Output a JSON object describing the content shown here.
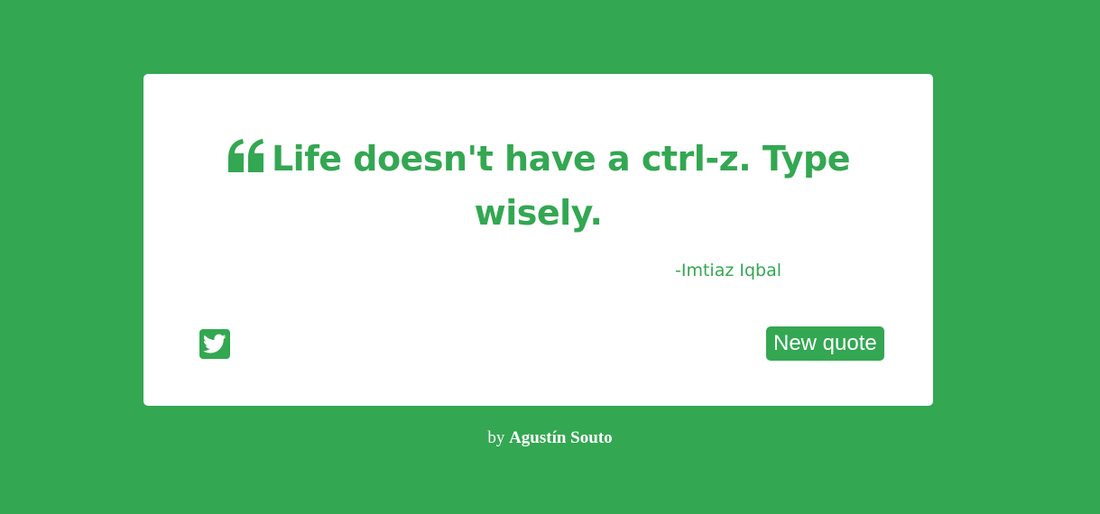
{
  "colors": {
    "background": "#33a752",
    "card": "#ffffff",
    "accent": "#33a752",
    "button_text": "#ffffff"
  },
  "quote": {
    "icon": "quote-left-icon",
    "text": "Life doesn't have a ctrl-z. Type wisely.",
    "author": "-Imtiaz Iqbal"
  },
  "actions": {
    "tweet_icon": "twitter-icon",
    "new_quote_label": "New quote"
  },
  "footer": {
    "prefix": "by",
    "author_name": "Agustín Souto"
  }
}
